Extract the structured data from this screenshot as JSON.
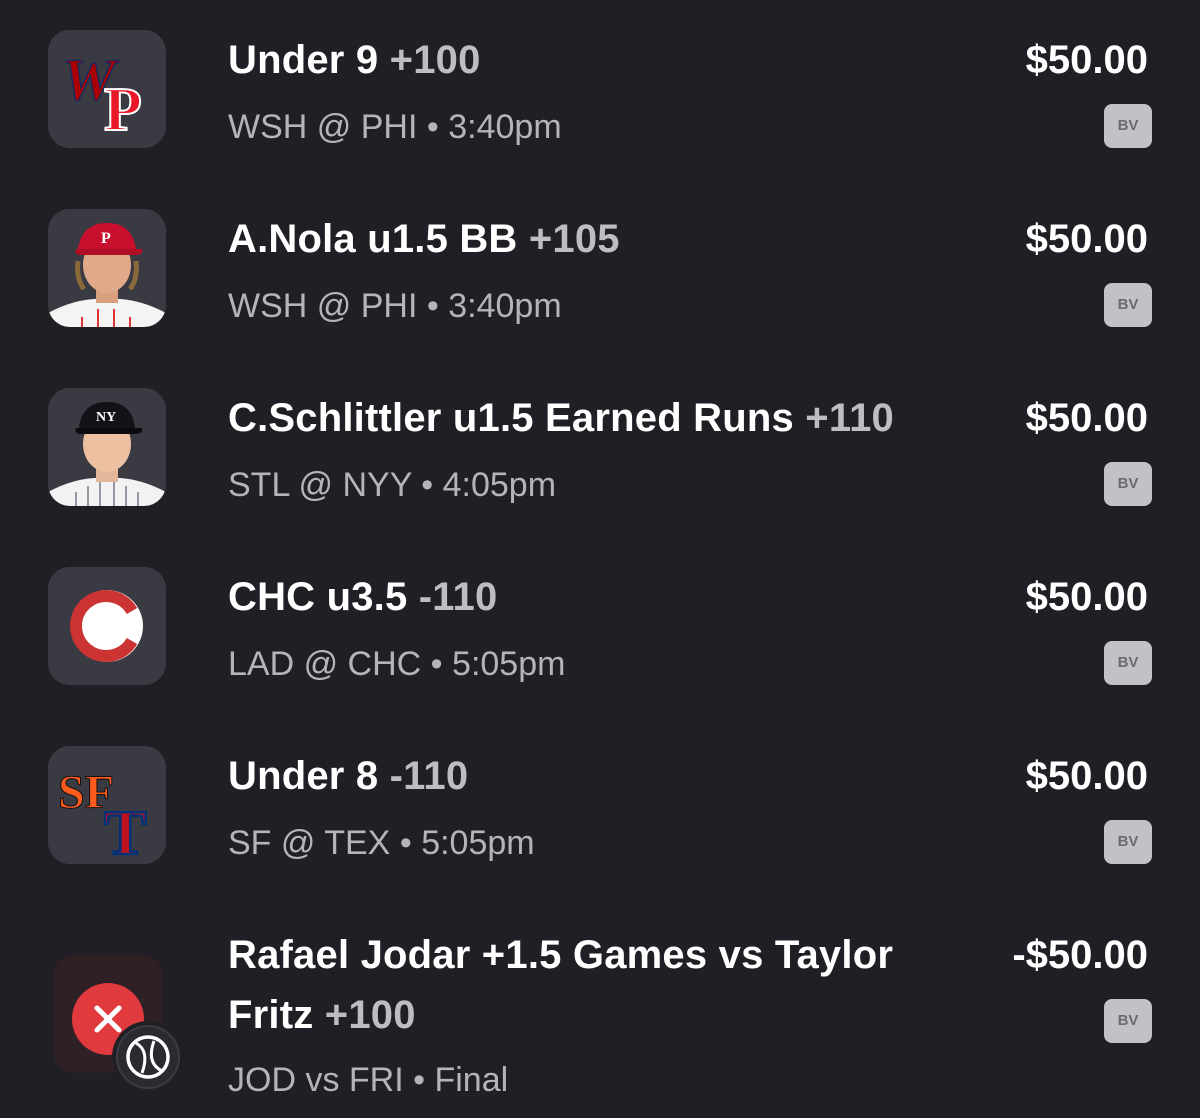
{
  "bets": [
    {
      "title": "Under 9",
      "odds": "+100",
      "matchup": "WSH @ PHI",
      "time": "3:40pm",
      "amount": "$50.00",
      "badge": "BV",
      "icon": "wsh-phi-logo-icon"
    },
    {
      "title": "A.Nola u1.5 BB",
      "odds": "+105",
      "matchup": "WSH @ PHI",
      "time": "3:40pm",
      "amount": "$50.00",
      "badge": "BV",
      "icon": "player-headshot-icon"
    },
    {
      "title": "C.Schlittler u1.5 Earned Runs",
      "odds": "+110",
      "matchup": "STL @ NYY",
      "time": "4:05pm",
      "amount": "$50.00",
      "badge": "BV",
      "icon": "player-headshot-icon"
    },
    {
      "title": "CHC u3.5",
      "odds": "-110",
      "matchup": "LAD @ CHC",
      "time": "5:05pm",
      "amount": "$50.00",
      "badge": "BV",
      "icon": "cubs-logo-icon"
    },
    {
      "title": "Under 8",
      "odds": "-110",
      "matchup": "SF @ TEX",
      "time": "5:05pm",
      "amount": "$50.00",
      "badge": "BV",
      "icon": "sf-tex-logo-icon"
    },
    {
      "title_line1": "Rafael Jodar +1.5 Games vs Taylor",
      "title_line2": "Fritz",
      "odds": "+100",
      "matchup": "JOD vs FRI",
      "time": "Final",
      "amount": "-$50.00",
      "badge": "BV",
      "icon": "lost-x-icon"
    }
  ],
  "separator": "•",
  "colors": {
    "background": "#1f1f25",
    "lost_red": "#e0393e",
    "phillies_red": "#c8102e",
    "giants_orange": "#fd5a1e",
    "rangers_blue": "#003278"
  }
}
